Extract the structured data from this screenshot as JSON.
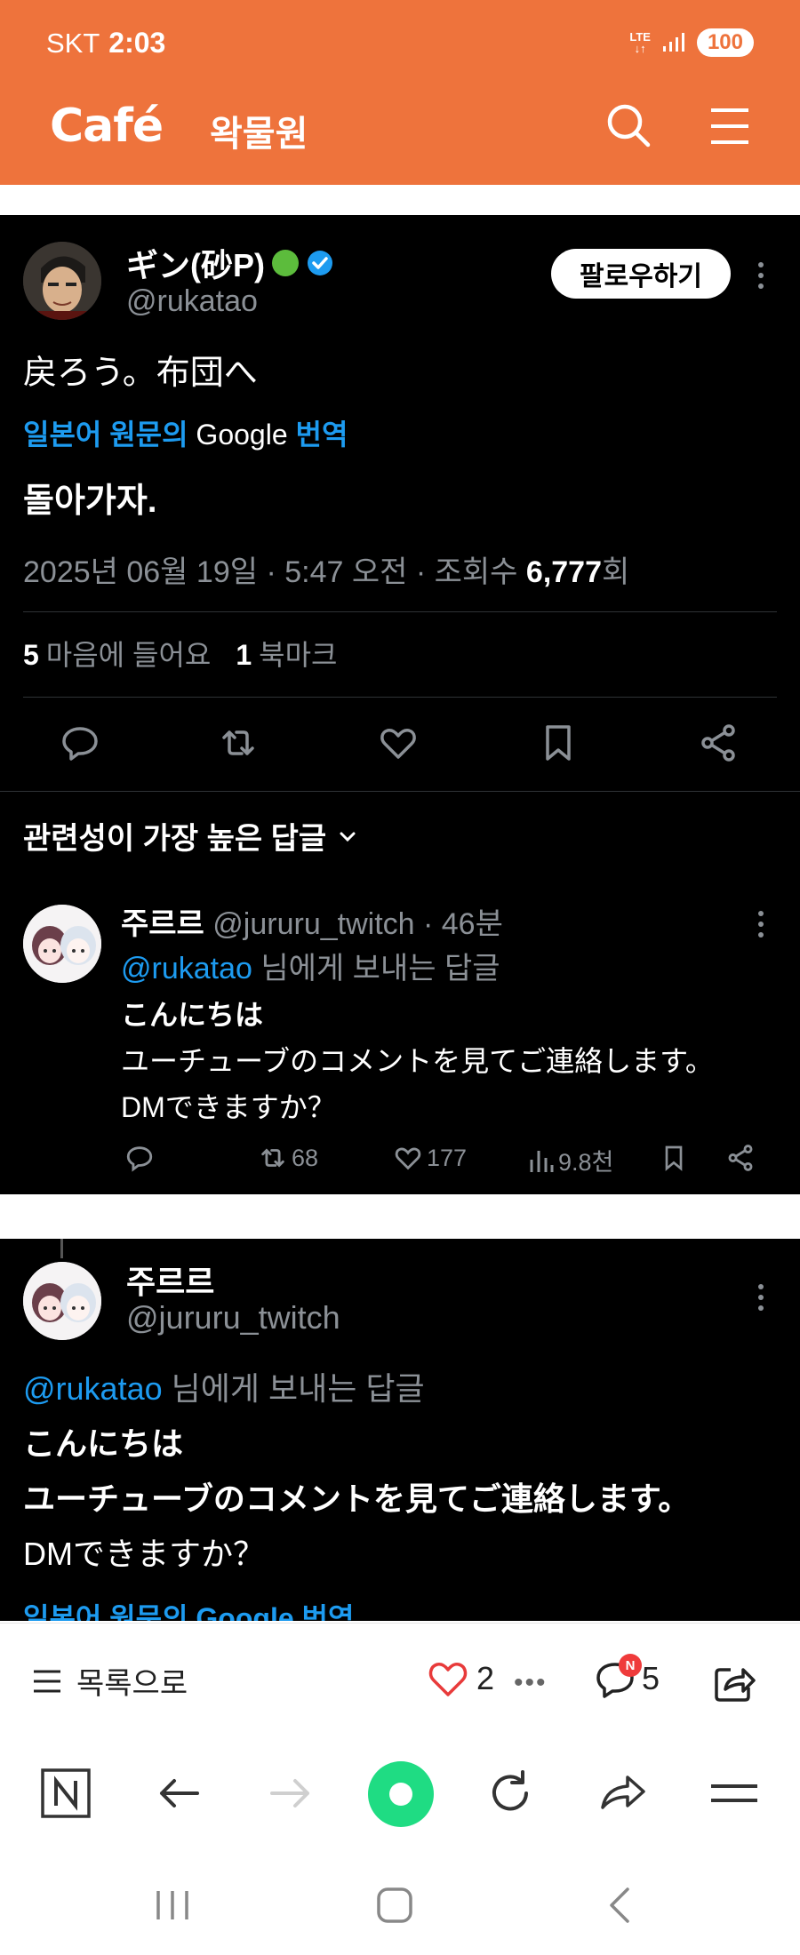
{
  "status_bar": {
    "carrier": "SKT",
    "time": "2:03",
    "network": "LTE",
    "battery": "100"
  },
  "header": {
    "brand": "Café",
    "cafe_name": "왁물원"
  },
  "tweet": {
    "author_name": "ギン(砂P)",
    "handle": "@rukatao",
    "follow_label": "팔로우하기",
    "text": "戻ろう。布団へ",
    "translate_prefix": "일본어 원문의",
    "translate_google": "Google",
    "translate_suffix": "번역",
    "translated_text": "돌아가자.",
    "date": "2025년 06월 19일 · 5:47 오전 · 조회수",
    "views": "6,777",
    "views_suffix": "회",
    "likes_count": "5",
    "likes_label": "마음에 들어요",
    "bookmarks_count": "1",
    "bookmarks_label": "북마크",
    "sort_label": "관련성이 가장 높은 답글"
  },
  "reply": {
    "author_name": "주르르",
    "handle_time": "@jururu_twitch · 46분",
    "reply_to_handle": "@rukatao",
    "reply_to_suffix": "님에게 보내는 답글",
    "lines": [
      "こんにちは",
      "ユーチューブのコメントを見てご連絡します。",
      "DMできますか？"
    ],
    "retweets": "68",
    "likes": "177",
    "views": "9.8천"
  },
  "tweet2": {
    "author_name": "주르르",
    "handle": "@jururu_twitch",
    "reply_to_handle": "@rukatao",
    "reply_to_suffix": "님에게 보내는 답글",
    "lines": [
      "こんにちは",
      "ユーチューブのコメントを見てご連絡します。",
      "DMできますか？"
    ],
    "translate_partial": "일본어 원문의 Google 번역"
  },
  "cafe_bar": {
    "list_label": "목록으로",
    "likes": "2",
    "comments": "5",
    "new_badge": "N"
  },
  "colors": {
    "brand_orange": "#ee733c",
    "link_blue": "#1d9bf0",
    "green": "#1fdc83"
  }
}
